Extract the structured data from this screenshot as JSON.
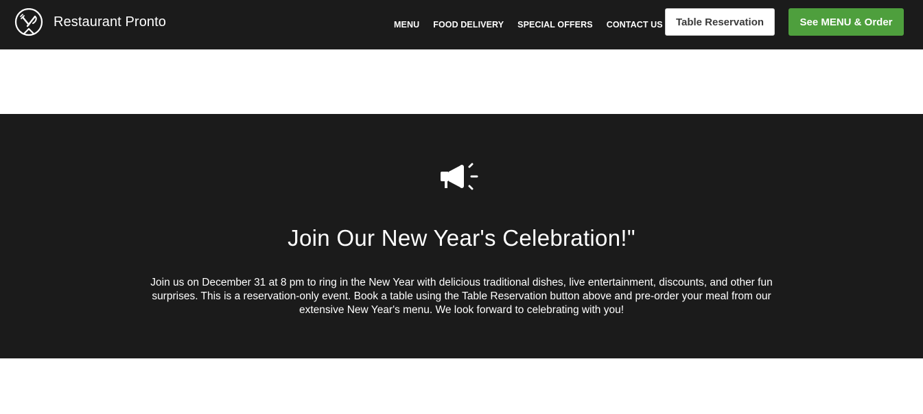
{
  "header": {
    "brand_name": "Restaurant Pronto",
    "logo_icon": "plate-fork-knife-icon",
    "nav": [
      {
        "label": "MENU"
      },
      {
        "label": "FOOD DELIVERY"
      },
      {
        "label": "SPECIAL OFFERS"
      },
      {
        "label": "CONTACT US"
      }
    ],
    "reservation_button": "Table Reservation",
    "order_button": "See MENU & Order"
  },
  "announcement": {
    "icon": "megaphone-icon",
    "title": "Join Our New Year's Celebration!\"",
    "body": "Join us on December 31 at 8 pm to ring in the New Year with delicious traditional dishes, live entertainment, discounts, and other fun surprises. This is a reservation-only event. Book a table using the Table Reservation button above and pre-order your meal from our extensive New Year's menu. We look forward to celebrating with you!"
  },
  "colors": {
    "header_bg": "#1b1b1b",
    "order_button_bg": "#4e9f3d",
    "announcement_bg": "#1b1b1b",
    "page_bg": "#ffffff"
  }
}
